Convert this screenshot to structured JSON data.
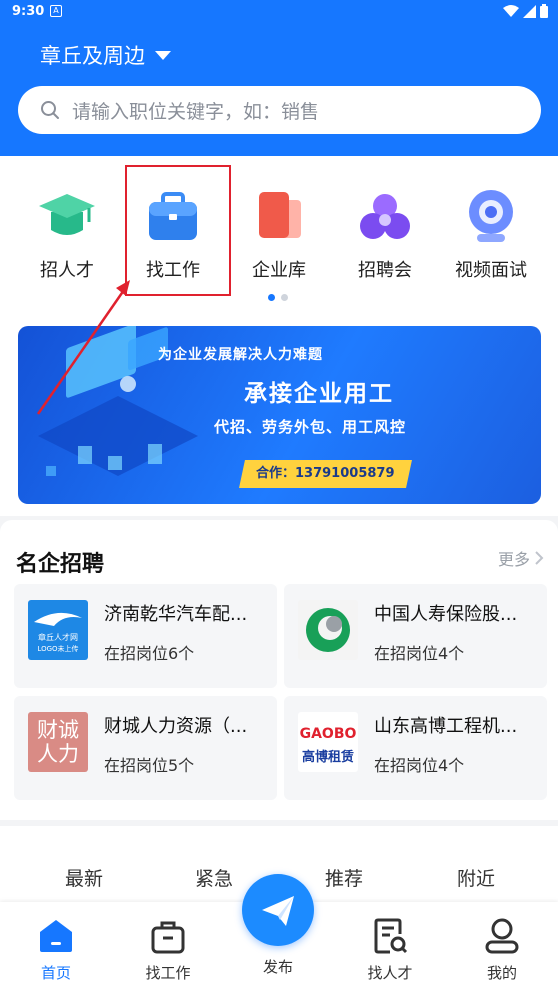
{
  "status": {
    "time": "9:30",
    "notif": "A"
  },
  "header": {
    "location": "章丘及周边",
    "search_placeholder": "请输入职位关键字，如：销售"
  },
  "menu": [
    {
      "label": "招人才",
      "icon": "graduation-cap-icon"
    },
    {
      "label": "找工作",
      "icon": "briefcase-icon"
    },
    {
      "label": "企业库",
      "icon": "company-book-icon"
    },
    {
      "label": "招聘会",
      "icon": "job-fair-icon"
    },
    {
      "label": "视频面试",
      "icon": "video-camera-icon"
    }
  ],
  "banner": {
    "top": "为企业发展解决人力难题",
    "main": "承接企业用工",
    "sub": "代招、劳务外包、用工风控",
    "contact": "合作：13791005879"
  },
  "companies": {
    "title": "名企招聘",
    "more": "更多",
    "items": [
      {
        "name": "济南乾华汽车配...",
        "count": "在招岗位6个",
        "logo_text": "章丘人才网",
        "logo_sub": "LOGO未上传"
      },
      {
        "name": "中国人寿保险股...",
        "count": "在招岗位4个"
      },
      {
        "name": "财城人力资源（...",
        "count": "在招岗位5个",
        "logo_text": "财诚人力"
      },
      {
        "name": "山东高博工程机...",
        "count": "在招岗位4个",
        "logo_text": "GAOBO",
        "logo_sub": "高博租赁"
      }
    ]
  },
  "filters": [
    "最新",
    "紧急",
    "推荐",
    "附近"
  ],
  "nav": [
    {
      "label": "首页",
      "icon": "home-icon"
    },
    {
      "label": "找工作",
      "icon": "briefcase-outline-icon"
    },
    {
      "label": "发布",
      "icon": "paper-plane-icon"
    },
    {
      "label": "找人才",
      "icon": "resume-search-icon"
    },
    {
      "label": "我的",
      "icon": "user-icon"
    }
  ],
  "colors": {
    "primary": "#1677ff",
    "highlight": "#e0212e"
  }
}
